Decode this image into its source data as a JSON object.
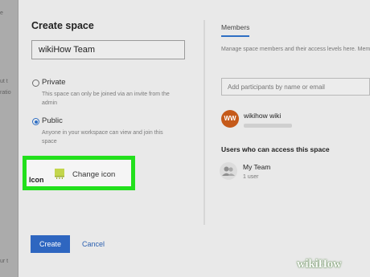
{
  "background": {
    "fragments": [
      "e",
      "ut t",
      "ratio",
      "ur t"
    ]
  },
  "dialog": {
    "title": "Create space",
    "name_value": "wikiHow Team",
    "privacy": {
      "private_label": "Private",
      "private_desc": "This space can only be joined via an invite from the admin",
      "public_label": "Public",
      "public_desc": "Anyone in your workspace can view and join this space",
      "selected": "Public"
    },
    "icon_label": "Icon",
    "change_icon_label": "Change icon",
    "create_label": "Create",
    "cancel_label": "Cancel"
  },
  "members": {
    "tab_label": "Members",
    "description": "Manage space members and their access levels here. Members will see this space in their left-hand navigation panel.",
    "add_placeholder": "Add participants by name or email",
    "member": {
      "initials": "WW",
      "name": "wikihow wiki"
    },
    "access_heading": "Users who can access this space",
    "team": {
      "name": "My Team",
      "count": "1 user"
    }
  },
  "watermark": "wikiHow",
  "colors": {
    "highlight": "#22e01c",
    "accent": "#2e66c0",
    "avatar": "#c55a1a"
  }
}
